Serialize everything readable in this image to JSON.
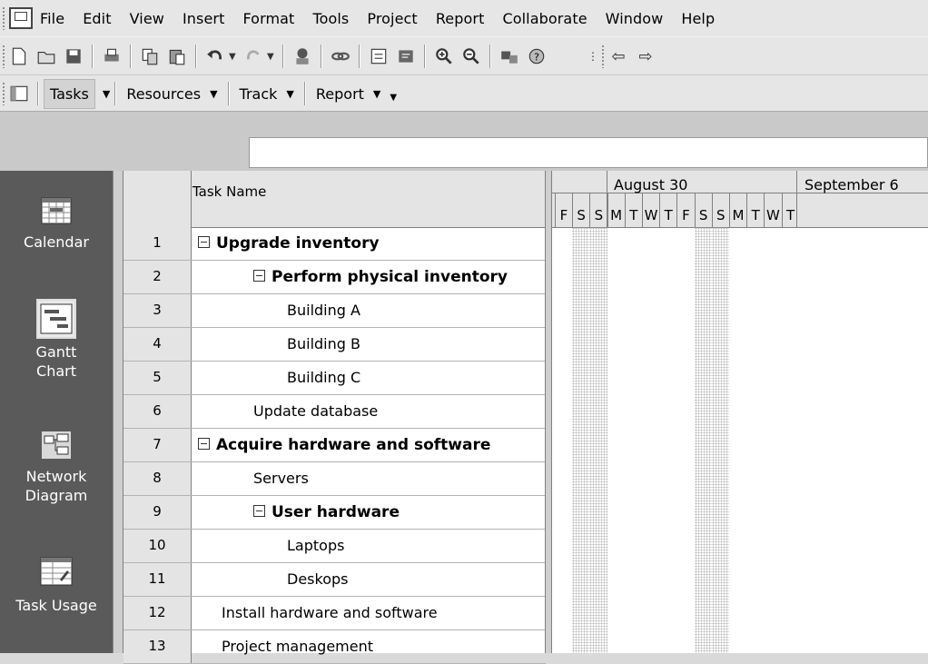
{
  "menu": [
    "File",
    "Edit",
    "View",
    "Insert",
    "Format",
    "Tools",
    "Project",
    "Report",
    "Collaborate",
    "Window",
    "Help"
  ],
  "guide": {
    "tasks": "Tasks",
    "resources": "Resources",
    "track": "Track",
    "report": "Report"
  },
  "views": [
    {
      "label": "Calendar",
      "icon": "calendar-view-icon"
    },
    {
      "label": "Gantt Chart",
      "icon": "gantt-chart-view-icon"
    },
    {
      "label": "Network Diagram",
      "icon": "network-diagram-view-icon"
    },
    {
      "label": "Task Usage",
      "icon": "task-usage-view-icon"
    }
  ],
  "table": {
    "name_header": "Task Name",
    "rows": [
      {
        "id": "1",
        "name": "Upgrade inventory",
        "summary": true,
        "level": 0
      },
      {
        "id": "2",
        "name": "Perform physical inventory",
        "summary": true,
        "level": 1
      },
      {
        "id": "3",
        "name": "Building A",
        "summary": false,
        "level": 2
      },
      {
        "id": "4",
        "name": "Building B",
        "summary": false,
        "level": 2
      },
      {
        "id": "5",
        "name": "Building C",
        "summary": false,
        "level": 2
      },
      {
        "id": "6",
        "name": "Update database",
        "summary": false,
        "level": 1
      },
      {
        "id": "7",
        "name": "Acquire hardware and software",
        "summary": true,
        "level": 0
      },
      {
        "id": "8",
        "name": "Servers",
        "summary": false,
        "level": 1
      },
      {
        "id": "9",
        "name": "User hardware",
        "summary": true,
        "level": 1
      },
      {
        "id": "10",
        "name": "Laptops",
        "summary": false,
        "level": 2
      },
      {
        "id": "11",
        "name": "Deskops",
        "summary": false,
        "level": 2
      },
      {
        "id": "12",
        "name": "Install hardware and software",
        "summary": false,
        "level": 0
      },
      {
        "id": "13",
        "name": "Project management",
        "summary": false,
        "level": 0
      }
    ]
  },
  "timescale": {
    "weeks": [
      "August 30",
      "September 6"
    ],
    "days": [
      "F",
      "S",
      "S",
      "M",
      "T",
      "W",
      "T",
      "F",
      "S",
      "S",
      "M",
      "T",
      "W",
      "T"
    ]
  }
}
